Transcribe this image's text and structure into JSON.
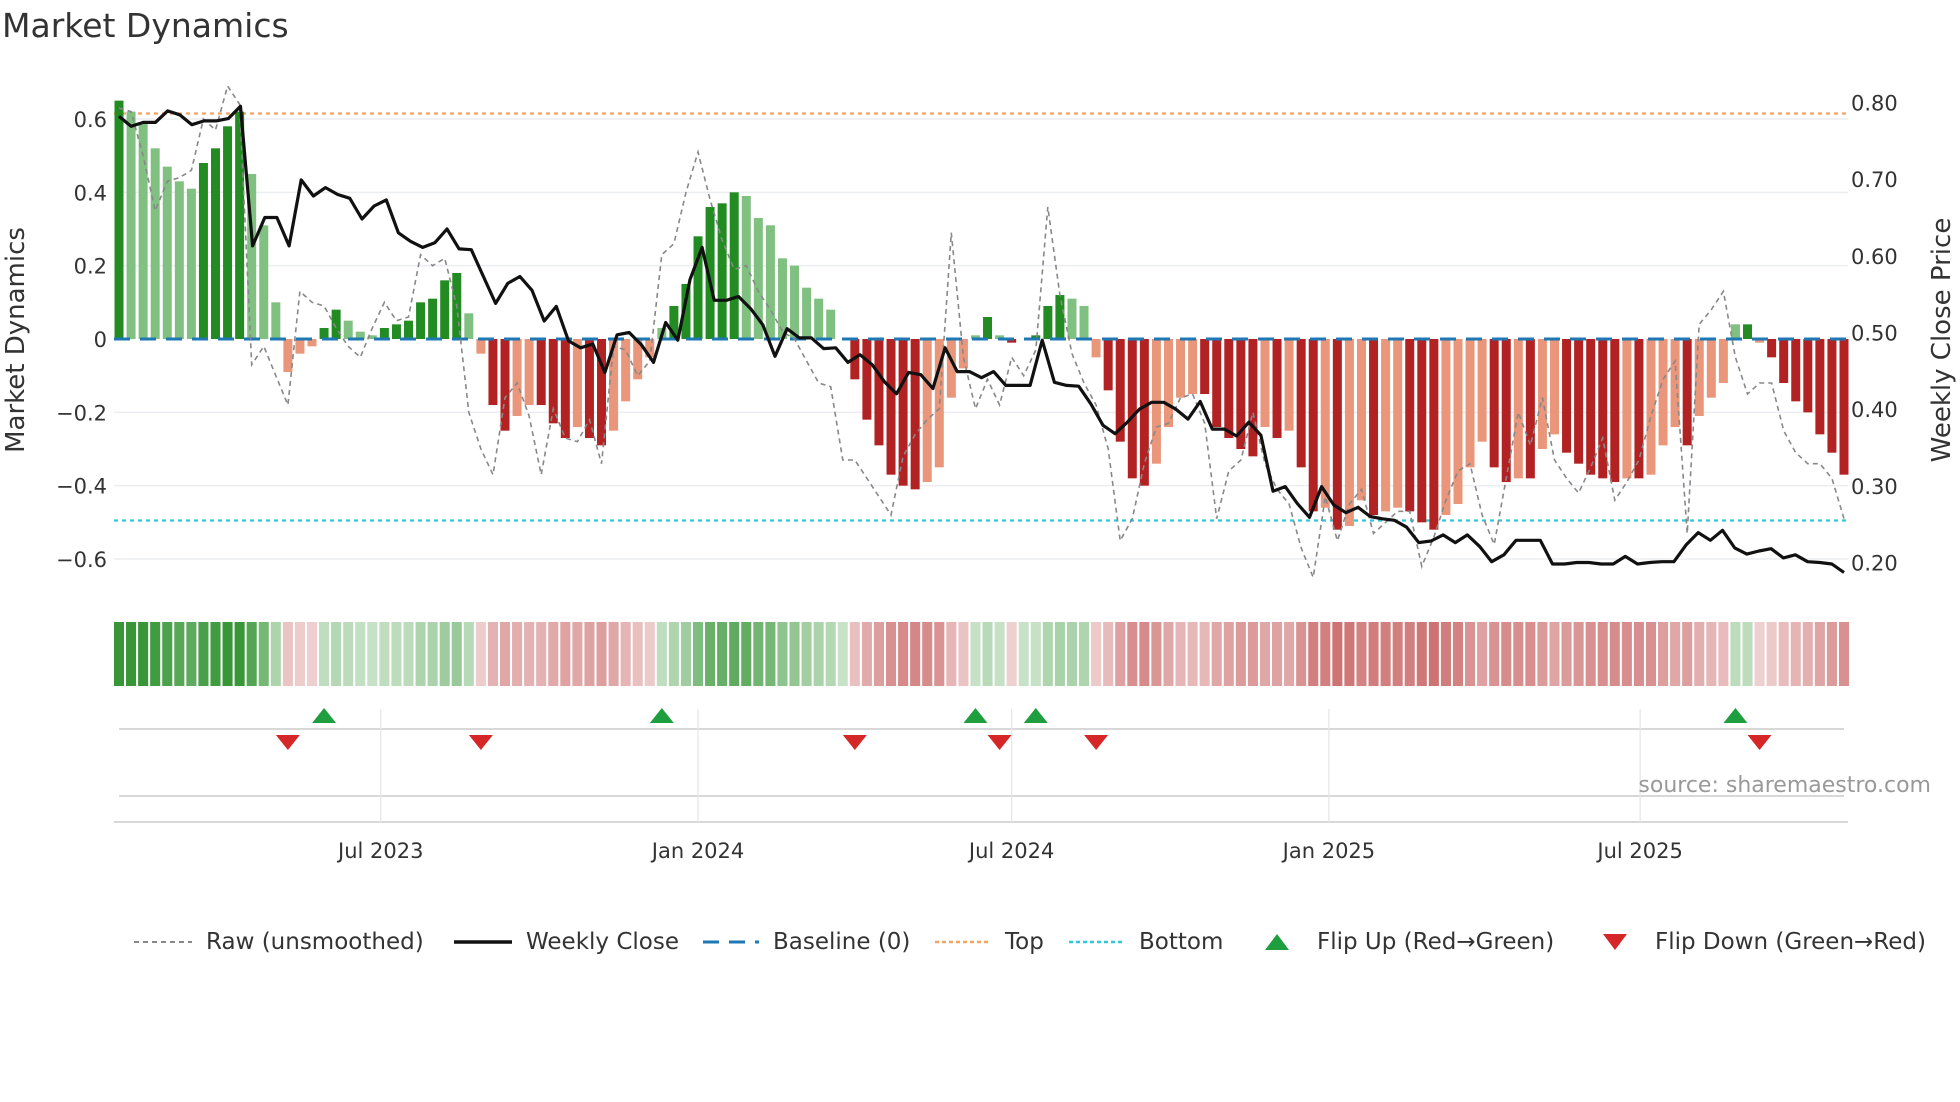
{
  "title": "Market Dynamics",
  "source": "source: sharemaestro.com",
  "colors": {
    "dark_green": "#228b22",
    "light_green": "#80c080",
    "dark_red": "#b22222",
    "light_red": "#e9967a",
    "close": "#111111",
    "raw": "#888888",
    "baseline": "#1f77b4",
    "top": "#f4a460",
    "bottom": "#30c8d8",
    "flip_up": "#1e9e3e",
    "flip_down": "#d62728"
  },
  "legend": {
    "raw": "Raw (unsmoothed)",
    "close": "Weekly Close",
    "baseline": "Baseline (0)",
    "top": "Top",
    "bottom": "Bottom",
    "flip_up": "Flip Up (Red→Green)",
    "flip_down": "Flip Down (Green→Red)"
  },
  "chart_data": {
    "type": "bar",
    "title": "Market Dynamics",
    "ylabel": "Market Dynamics",
    "y2label": "Weekly Close Price",
    "ylim": [
      -0.7,
      0.7
    ],
    "y2lim": [
      0.17,
      0.85
    ],
    "yticks": [
      {
        "v": 0.6,
        "label": "0.6"
      },
      {
        "v": 0.4,
        "label": "0.4"
      },
      {
        "v": 0.2,
        "label": "0.2"
      },
      {
        "v": 0,
        "label": "0"
      },
      {
        "v": -0.2,
        "label": "−0.2"
      },
      {
        "v": -0.4,
        "label": "−0.4"
      },
      {
        "v": -0.6,
        "label": "−0.6"
      }
    ],
    "y2ticks": [
      {
        "v": 0.8,
        "label": "0.80"
      },
      {
        "v": 0.7,
        "label": "0.70"
      },
      {
        "v": 0.6,
        "label": "0.60"
      },
      {
        "v": 0.5,
        "label": "0.50"
      },
      {
        "v": 0.4,
        "label": "0.40"
      },
      {
        "v": 0.3,
        "label": "0.30"
      },
      {
        "v": 0.2,
        "label": "0.20"
      }
    ],
    "xticks": [
      {
        "week": 21.7,
        "label": "Jul 2023"
      },
      {
        "week": 48.0,
        "label": "Jan 2024"
      },
      {
        "week": 74.0,
        "label": "Jul 2024"
      },
      {
        "week": 100.3,
        "label": "Jan 2025"
      },
      {
        "week": 126.1,
        "label": "Jul 2025"
      }
    ],
    "top_level": 0.615,
    "bottom_level": -0.495,
    "baseline": 0,
    "bars": [
      0.65,
      0.62,
      0.59,
      0.52,
      0.47,
      0.43,
      0.41,
      0.48,
      0.52,
      0.58,
      0.62,
      0.45,
      0.31,
      0.1,
      -0.09,
      -0.04,
      -0.02,
      0.03,
      0.08,
      0.05,
      0.02,
      0.01,
      0.03,
      0.04,
      0.05,
      0.1,
      0.11,
      0.16,
      0.18,
      0.07,
      -0.04,
      -0.18,
      -0.25,
      -0.21,
      -0.18,
      -0.18,
      -0.23,
      -0.27,
      -0.24,
      -0.27,
      -0.29,
      -0.25,
      -0.17,
      -0.11,
      -0.05,
      0.03,
      0.09,
      0.15,
      0.28,
      0.36,
      0.37,
      0.4,
      0.39,
      0.33,
      0.31,
      0.22,
      0.2,
      0.14,
      0.11,
      0.08,
      0.0,
      -0.11,
      -0.22,
      -0.29,
      -0.37,
      -0.4,
      -0.41,
      -0.39,
      -0.35,
      -0.16,
      -0.08,
      0.01,
      0.06,
      0.01,
      -0.01,
      0.0,
      0.01,
      0.09,
      0.12,
      0.11,
      0.09,
      -0.05,
      -0.14,
      -0.28,
      -0.38,
      -0.4,
      -0.34,
      -0.24,
      -0.16,
      -0.15,
      -0.15,
      -0.24,
      -0.27,
      -0.3,
      -0.32,
      -0.24,
      -0.27,
      -0.25,
      -0.35,
      -0.47,
      -0.46,
      -0.52,
      -0.51,
      -0.44,
      -0.48,
      -0.47,
      -0.46,
      -0.47,
      -0.5,
      -0.52,
      -0.48,
      -0.45,
      -0.35,
      -0.28,
      -0.35,
      -0.39,
      -0.38,
      -0.38,
      -0.3,
      -0.26,
      -0.31,
      -0.34,
      -0.37,
      -0.38,
      -0.39,
      -0.38,
      -0.38,
      -0.37,
      -0.29,
      -0.24,
      -0.29,
      -0.21,
      -0.16,
      -0.12,
      0.04,
      0.04,
      -0.01,
      -0.05,
      -0.12,
      -0.17,
      -0.2,
      -0.26,
      -0.31,
      -0.37
    ],
    "weekly_close": [
      0.782,
      0.769,
      0.774,
      0.774,
      0.789,
      0.784,
      0.771,
      0.776,
      0.776,
      0.779,
      0.795,
      0.613,
      0.65,
      0.65,
      0.613,
      0.699,
      0.678,
      0.689,
      0.68,
      0.675,
      0.648,
      0.665,
      0.673,
      0.63,
      0.619,
      0.611,
      0.617,
      0.635,
      0.609,
      0.608,
      0.573,
      0.538,
      0.564,
      0.573,
      0.555,
      0.515,
      0.534,
      0.489,
      0.48,
      0.485,
      0.448,
      0.497,
      0.5,
      0.484,
      0.461,
      0.513,
      0.49,
      0.569,
      0.611,
      0.542,
      0.542,
      0.547,
      0.531,
      0.51,
      0.469,
      0.505,
      0.493,
      0.493,
      0.479,
      0.48,
      0.461,
      0.471,
      0.458,
      0.436,
      0.42,
      0.448,
      0.445,
      0.427,
      0.48,
      0.449,
      0.449,
      0.441,
      0.449,
      0.431,
      0.431,
      0.431,
      0.49,
      0.435,
      0.431,
      0.43,
      0.407,
      0.379,
      0.368,
      0.383,
      0.4,
      0.409,
      0.409,
      0.4,
      0.387,
      0.41,
      0.374,
      0.374,
      0.365,
      0.383,
      0.366,
      0.293,
      0.299,
      0.277,
      0.259,
      0.299,
      0.275,
      0.265,
      0.272,
      0.26,
      0.257,
      0.255,
      0.246,
      0.226,
      0.228,
      0.236,
      0.226,
      0.236,
      0.221,
      0.201,
      0.21,
      0.229,
      0.229,
      0.229,
      0.198,
      0.198,
      0.2,
      0.2,
      0.198,
      0.198,
      0.208,
      0.198,
      0.2,
      0.201,
      0.201,
      0.223,
      0.239,
      0.229,
      0.242,
      0.219,
      0.211,
      0.215,
      0.218,
      0.206,
      0.21,
      0.201,
      0.2,
      0.198,
      0.187
    ],
    "raw": [
      0.63,
      0.62,
      0.5,
      0.35,
      0.43,
      0.44,
      0.46,
      0.6,
      0.57,
      0.69,
      0.64,
      -0.07,
      -0.02,
      -0.1,
      -0.18,
      0.13,
      0.1,
      0.09,
      0.03,
      -0.02,
      -0.05,
      0.03,
      0.1,
      0.05,
      0.06,
      0.23,
      0.2,
      0.22,
      0.09,
      -0.2,
      -0.3,
      -0.37,
      -0.16,
      -0.12,
      -0.21,
      -0.37,
      -0.19,
      -0.27,
      -0.28,
      -0.22,
      -0.34,
      -0.02,
      -0.03,
      -0.1,
      -0.06,
      0.23,
      0.26,
      0.4,
      0.51,
      0.38,
      0.27,
      0.19,
      0.2,
      0.13,
      0.08,
      0.02,
      0.0,
      -0.06,
      -0.12,
      -0.13,
      -0.33,
      -0.33,
      -0.38,
      -0.43,
      -0.48,
      -0.32,
      -0.26,
      -0.22,
      -0.19,
      0.29,
      -0.05,
      -0.19,
      -0.11,
      -0.18,
      -0.05,
      -0.1,
      -0.03,
      0.36,
      0.12,
      -0.04,
      -0.12,
      -0.18,
      -0.3,
      -0.55,
      -0.49,
      -0.34,
      -0.24,
      -0.23,
      -0.16,
      -0.15,
      -0.23,
      -0.49,
      -0.36,
      -0.33,
      -0.2,
      -0.34,
      -0.41,
      -0.45,
      -0.57,
      -0.65,
      -0.43,
      -0.55,
      -0.45,
      -0.41,
      -0.53,
      -0.5,
      -0.47,
      -0.47,
      -0.62,
      -0.54,
      -0.44,
      -0.36,
      -0.34,
      -0.48,
      -0.56,
      -0.38,
      -0.2,
      -0.29,
      -0.16,
      -0.33,
      -0.38,
      -0.42,
      -0.35,
      -0.27,
      -0.44,
      -0.39,
      -0.33,
      -0.21,
      -0.11,
      -0.06,
      -0.53,
      0.04,
      0.08,
      0.13,
      -0.05,
      -0.15,
      -0.12,
      -0.12,
      -0.25,
      -0.31,
      -0.34,
      -0.34,
      -0.38,
      -0.49
    ],
    "flip_up_weeks": [
      17,
      45,
      71,
      76,
      134
    ],
    "flip_down_weeks": [
      14,
      30,
      61,
      73,
      81,
      136
    ]
  }
}
